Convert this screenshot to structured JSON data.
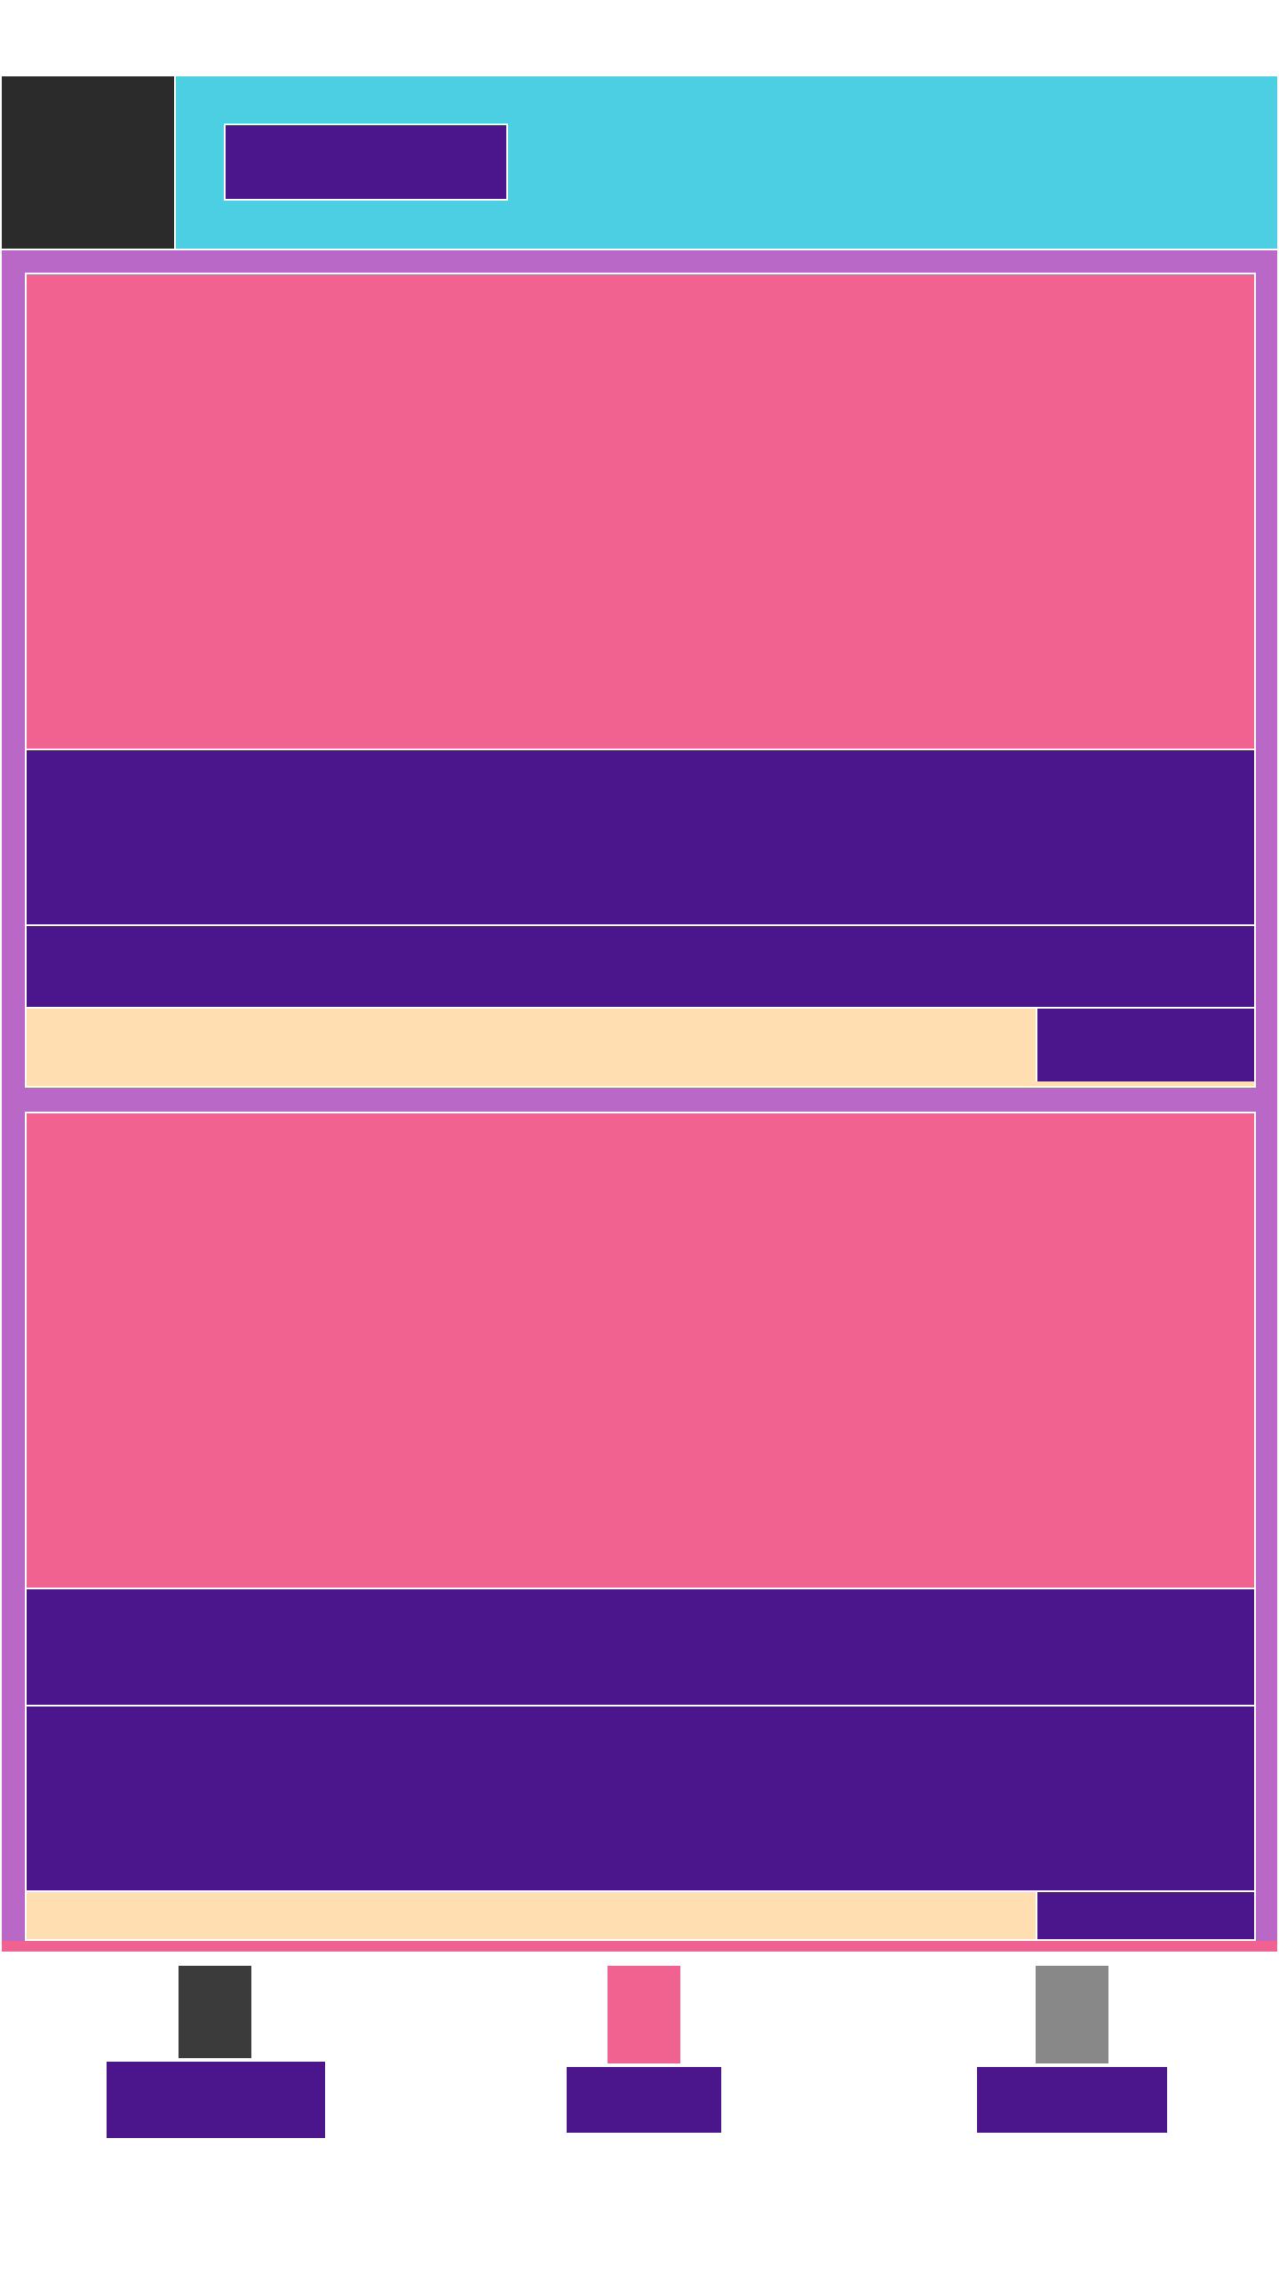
{
  "header": {
    "button_label": ""
  },
  "cards": [
    {
      "title": "",
      "subtitle": "",
      "footer_text": "",
      "action_label": ""
    },
    {
      "title": "",
      "subtitle": "",
      "footer_text": "",
      "action_label": ""
    }
  ],
  "bottom_nav": [
    {
      "label": "",
      "icon": "nav-icon-dark",
      "color": "#3b3b3b"
    },
    {
      "label": "",
      "icon": "nav-icon-pink",
      "color": "#f06391"
    },
    {
      "label": "",
      "icon": "nav-icon-gray",
      "color": "#888888"
    }
  ],
  "colors": {
    "header_bg": "#4dcfe3",
    "logo_bg": "#2b2b2b",
    "main_bg": "#b968c8",
    "image_bg": "#f06391",
    "accent": "#4b168b",
    "footer_bg": "#ffdfb2"
  }
}
